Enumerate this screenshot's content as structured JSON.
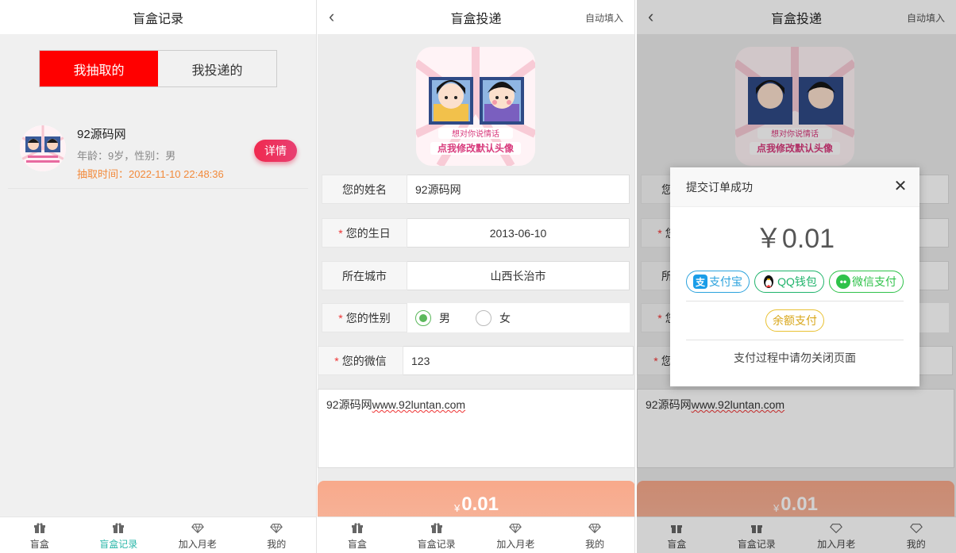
{
  "records": {
    "title": "盲盒记录",
    "tab_drawn": "我抽取的",
    "tab_sent": "我投递的",
    "item": {
      "name": "92源码网",
      "meta": "年龄：9岁，性别：男",
      "time": "抽取时间：2022-11-10 22:48:36",
      "detail": "详情"
    }
  },
  "form": {
    "title": "盲盒投递",
    "autofill": "自动填入",
    "name_label": "您的姓名",
    "name_value": "92源码网",
    "birthday_label": "您的生日",
    "birthday_value": "2013-06-10",
    "city_label": "所在城市",
    "city_value": "山西长治市",
    "gender_label": "您的性别",
    "gender_options": [
      "男",
      "女"
    ],
    "gender_selected": "男",
    "wechat_label": "您的微信",
    "wechat_value": "123",
    "message_prefix": "92源码网",
    "message_link": "www.92luntan.com",
    "star": "*",
    "currency": "¥",
    "amount": "0.01",
    "avatar_text_1": "想对你说情话",
    "avatar_text_2": "点我修改默认头像"
  },
  "modal": {
    "title": "提交订单成功",
    "price": "￥0.01",
    "alipay": "支付宝",
    "qq": "QQ钱包",
    "wechat": "微信支付",
    "balance": "余额支付",
    "note": "支付过程中请勿关闭页面"
  },
  "tabbar": {
    "items": [
      "盲盒",
      "盲盒记录",
      "加入月老",
      "我的"
    ],
    "active_color": "#2bb7a9"
  },
  "colors": {
    "segment_active": "#ff0000",
    "detail_button": "#f0294f",
    "time_text": "#f28a3b"
  }
}
